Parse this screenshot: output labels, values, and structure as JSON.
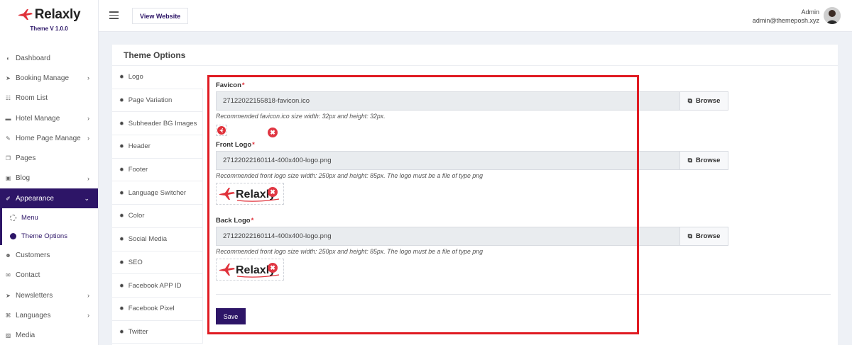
{
  "brand": {
    "name": "Relaxly",
    "version": "Theme V 1.0.0"
  },
  "topbar": {
    "view_website": "View Website",
    "user_role": "Admin",
    "user_email": "admin@themeposh.xyz"
  },
  "sidebar": {
    "items": [
      {
        "label": "Dashboard",
        "icon": "dashboard-icon",
        "chevron": false
      },
      {
        "label": "Booking Manage",
        "icon": "paper-plane-icon",
        "chevron": true
      },
      {
        "label": "Room List",
        "icon": "list-icon",
        "chevron": false
      },
      {
        "label": "Hotel Manage",
        "icon": "bed-icon",
        "chevron": true
      },
      {
        "label": "Home Page Manage",
        "icon": "edit-icon",
        "chevron": true
      },
      {
        "label": "Pages",
        "icon": "pages-icon",
        "chevron": false
      },
      {
        "label": "Blog",
        "icon": "blog-icon",
        "chevron": true
      },
      {
        "label": "Appearance",
        "icon": "wrench-icon",
        "chevron": true,
        "active": true
      }
    ],
    "submenu": [
      {
        "label": "Menu"
      },
      {
        "label": "Theme Options",
        "active": true
      }
    ],
    "items_after": [
      {
        "label": "Customers",
        "icon": "users-icon",
        "chevron": false
      },
      {
        "label": "Contact",
        "icon": "envelope-icon",
        "chevron": false
      },
      {
        "label": "Newsletters",
        "icon": "paper-plane-icon",
        "chevron": true
      },
      {
        "label": "Languages",
        "icon": "language-icon",
        "chevron": true
      },
      {
        "label": "Media",
        "icon": "image-icon",
        "chevron": false
      }
    ]
  },
  "main": {
    "title": "Theme Options",
    "tabs": [
      "Logo",
      "Page Variation",
      "Subheader BG Images",
      "Header",
      "Footer",
      "Language Switcher",
      "Color",
      "Social Media",
      "SEO",
      "Facebook APP ID",
      "Facebook Pixel",
      "Twitter"
    ],
    "active_tab": "Logo",
    "favicon": {
      "label": "Favicon",
      "file": "27122022155818-favicon.ico",
      "browse": "Browse",
      "hint": "Recommended favicon.ico size width: 32px and height: 32px."
    },
    "front_logo": {
      "label": "Front Logo",
      "file": "27122022160114-400x400-logo.png",
      "browse": "Browse",
      "hint": "Recommended front logo size width: 250px and height: 85px. The logo must be a file of type png"
    },
    "back_logo": {
      "label": "Back Logo",
      "file": "27122022160114-400x400-logo.png",
      "browse": "Browse",
      "hint": "Recommended front logo size width: 250px and height: 85px. The logo must be a file of type png"
    },
    "required_mark": "*",
    "save": "Save",
    "remove_glyph": "✖"
  },
  "colors": {
    "accent": "#2d1567",
    "brand_red": "#e0323b",
    "highlight": "#e01b22"
  }
}
